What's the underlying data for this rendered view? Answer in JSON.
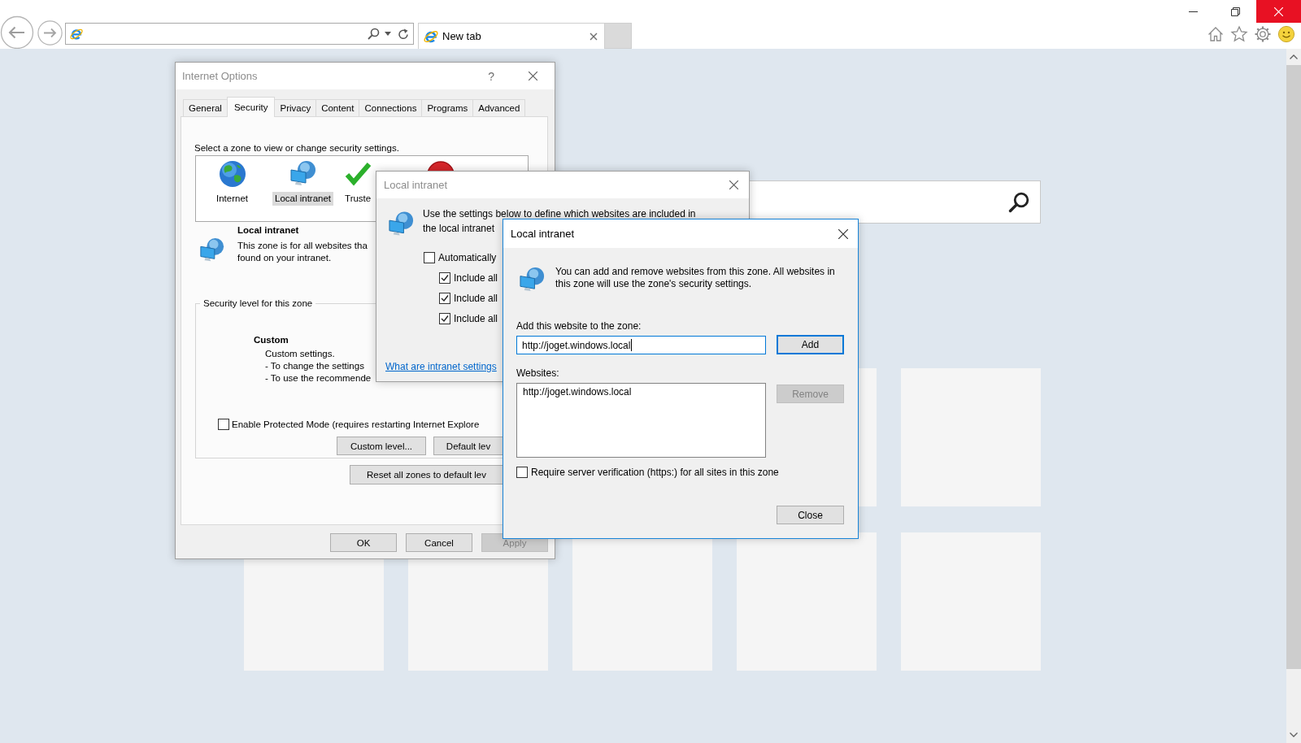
{
  "browser": {
    "tabs": [
      {
        "title": "New tab",
        "selected": true
      }
    ]
  },
  "internet_options": {
    "title": "Internet Options",
    "active": false,
    "help_glyph": "?",
    "tabs": [
      {
        "label": "General",
        "selected": false
      },
      {
        "label": "Security",
        "selected": true
      },
      {
        "label": "Privacy",
        "selected": false
      },
      {
        "label": "Content",
        "selected": false
      },
      {
        "label": "Connections",
        "selected": false
      },
      {
        "label": "Programs",
        "selected": false
      },
      {
        "label": "Advanced",
        "selected": false
      }
    ],
    "zone_prompt": "Select a zone to view or change security settings.",
    "zones": [
      {
        "kind": "internet",
        "label": "Internet",
        "selected": false
      },
      {
        "kind": "intranet",
        "label": "Local intranet",
        "selected": true
      },
      {
        "kind": "trusted",
        "label": "Truste",
        "selected": false
      },
      {
        "kind": "restricted",
        "selected": false
      }
    ],
    "zone_title": "Local intranet",
    "zone_description": [
      "This zone is for all websites tha",
      "found on your intranet."
    ],
    "security_level": {
      "legend": "Security level for this zone",
      "title": "Custom",
      "lines": [
        "Custom settings.",
        "- To change the settings",
        "- To use the recommende"
      ]
    },
    "protected_mode": {
      "label": "Enable Protected Mode (requires restarting Internet Explore",
      "checked": false
    },
    "custom_level_button": {
      "label": "Custom level..."
    },
    "default_level_button": {
      "label": "Default lev"
    },
    "reset_button": {
      "label": "Reset all zones to default lev"
    },
    "ok_button": {
      "label": "OK"
    },
    "cancel_button": {
      "label": "Cancel"
    },
    "apply_button": {
      "label": "Apply",
      "disabled": true
    }
  },
  "intranet_settings": {
    "title": "Local intranet",
    "active": false,
    "description_lines": [
      "Use the settings below to define which websites are included in",
      "the local intranet"
    ],
    "options": [
      {
        "label": "Automatically",
        "checked": false,
        "children": [
          {
            "label": "Include all",
            "checked": true
          },
          {
            "label": "Include all",
            "checked": true
          },
          {
            "label": "Include all",
            "checked": true
          }
        ]
      }
    ],
    "help_link": "What are intranet settings"
  },
  "sites_dialog": {
    "title": "Local intranet",
    "active": true,
    "description": "You can add and remove websites from this zone. All websites in this zone will use the zone's security settings.",
    "add_label": "Add this website to the zone:",
    "add_field": {
      "value": "http://joget.windows.local",
      "focused": true
    },
    "add_button": {
      "label": "Add",
      "default": true
    },
    "websites_label": "Websites:",
    "websites": [
      {
        "url": "http://joget.windows.local",
        "selected": false
      }
    ],
    "remove_button": {
      "label": "Remove",
      "disabled": true
    },
    "https_option": {
      "label": "Require server verification (https:) for all sites in this zone",
      "checked": false
    },
    "close_button": {
      "label": "Close"
    }
  }
}
